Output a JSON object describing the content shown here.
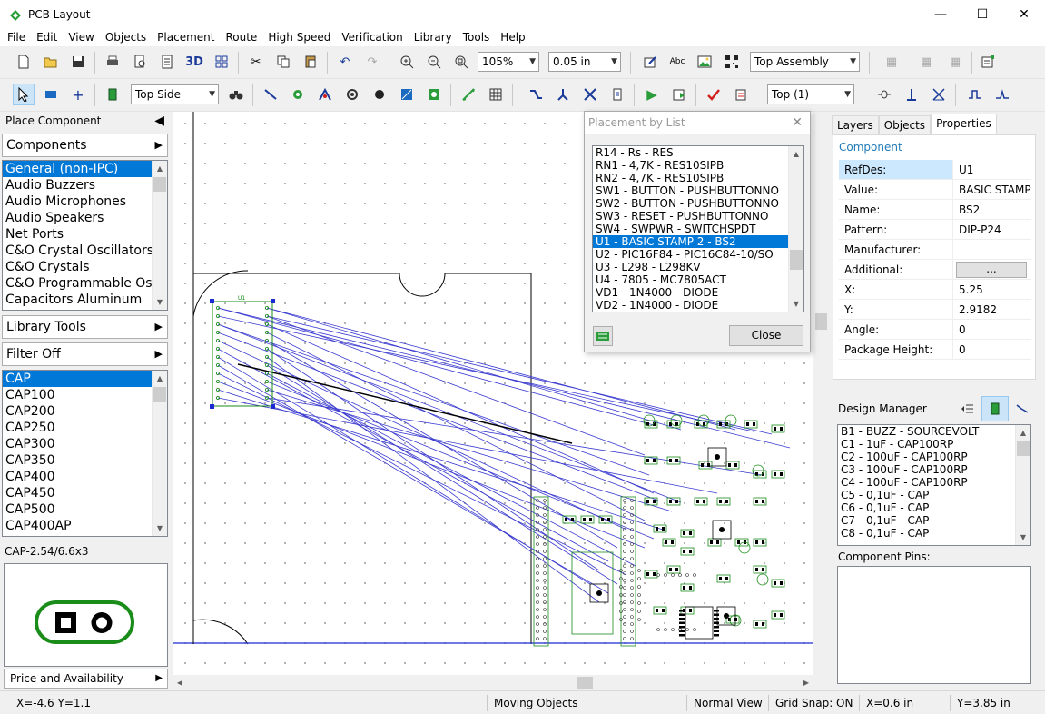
{
  "window": {
    "title": "PCB Layout"
  },
  "menu": [
    "File",
    "Edit",
    "View",
    "Objects",
    "Placement",
    "Route",
    "High Speed",
    "Verification",
    "Library",
    "Tools",
    "Help"
  ],
  "toolbar1": {
    "zoom": "105%",
    "grid": "0.05 in",
    "assembly": "Top Assembly",
    "three_d": "3D"
  },
  "toolbar2": {
    "side": "Top Side",
    "layer": "Top (1)"
  },
  "left_panel": {
    "header": "Place Component",
    "components_btn": "Components",
    "categories": [
      "General (non-IPC)",
      "Audio Buzzers",
      "Audio Microphones",
      "Audio Speakers",
      "Net Ports",
      "C&O Crystal Oscillators",
      "C&O Crystals",
      "C&O Programmable Osci",
      "Capacitors Aluminum"
    ],
    "library_tools_btn": "Library Tools",
    "filter_btn": "Filter Off",
    "patterns": [
      "CAP",
      "CAP100",
      "CAP200",
      "CAP250",
      "CAP300",
      "CAP350",
      "CAP400",
      "CAP450",
      "CAP500",
      "CAP400AP"
    ],
    "pattern_info": "CAP-2.54/6.6x3",
    "price_btn": "Price and Availability"
  },
  "canvas": {
    "component_label": "U1"
  },
  "dialog": {
    "title": "Placement by List",
    "items": [
      "R14 - Rs - RES",
      "RN1 - 4,7K - RES10SIPB",
      "RN2 - 4,7K - RES10SIPB",
      "SW1 - BUTTON - PUSHBUTTONNO",
      "SW2 - BUTTON - PUSHBUTTONNO",
      "SW3 - RESET - PUSHBUTTONNO",
      "SW4 - SWPWR - SWITCHSPDT",
      "U1 - BASIC STAMP 2 - BS2",
      "U2 - PIC16F84 - PIC16C84-10/SO",
      "U3 - L298 - L298KV",
      "U4 - 7805 - MC7805ACT",
      "VD1 - 1N4000 - DIODE",
      "VD2 - 1N4000 - DIODE"
    ],
    "close_btn": "Close"
  },
  "right_panel": {
    "tabs": [
      "Layers",
      "Objects",
      "Properties"
    ],
    "props_title": "Component",
    "props": [
      {
        "k": "RefDes:",
        "v": "U1"
      },
      {
        "k": "Value:",
        "v": "BASIC STAMP"
      },
      {
        "k": "Name:",
        "v": "BS2"
      },
      {
        "k": "Pattern:",
        "v": "DIP-P24"
      },
      {
        "k": "Manufacturer:",
        "v": ""
      },
      {
        "k": "Additional:",
        "v": "..."
      },
      {
        "k": "X:",
        "v": "5.25"
      },
      {
        "k": "Y:",
        "v": "2.9182"
      },
      {
        "k": "Angle:",
        "v": "0"
      },
      {
        "k": "Package Height:",
        "v": "0"
      }
    ],
    "dm_header": "Design Manager",
    "dm_items": [
      "B1 - BUZZ - SOURCEVOLT",
      "C1 - 1uF - CAP100RP",
      "C2 - 100uF - CAP100RP",
      "C3 - 100uF - CAP100RP",
      "C4 - 100uF - CAP100RP",
      "C5 - 0,1uF - CAP",
      "C6 - 0,1uF - CAP",
      "C7 - 0,1uF - CAP",
      "C8 - 0,1uF - CAP"
    ],
    "pins_label": "Component Pins:"
  },
  "status": {
    "coords": "X=-4.6  Y=1.1",
    "action": "Moving Objects",
    "view": "Normal View",
    "snap": "Grid Snap: ON",
    "x": "X=0.6 in",
    "y": "Y=3.85 in"
  },
  "colors": {
    "accent": "#0078d7",
    "ratsnest": "#3a3ad0",
    "copper_green": "#1a8c1a"
  }
}
